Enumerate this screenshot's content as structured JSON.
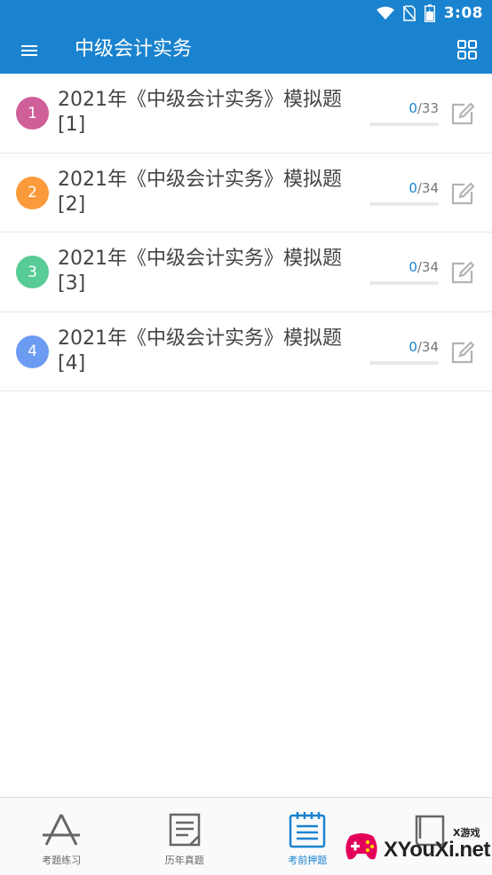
{
  "status_bar": {
    "time": "3:08"
  },
  "app_bar": {
    "title": "中级会计实务",
    "menu_icon": "hamburger-menu-icon",
    "grid_icon": "grid-view-icon"
  },
  "colors": {
    "primary": "#1a83cf"
  },
  "exams": [
    {
      "index": "1",
      "title": "2021年《中级会计实务》模拟题[1]",
      "done": "0",
      "total": "/33",
      "done_fraction": 0,
      "badge_color": "#cf5f99"
    },
    {
      "index": "2",
      "title": "2021年《中级会计实务》模拟题[2]",
      "done": "0",
      "total": "/34",
      "done_fraction": 0,
      "badge_color": "#fb9a3a"
    },
    {
      "index": "3",
      "title": "2021年《中级会计实务》模拟题[3]",
      "done": "0",
      "total": "/34",
      "done_fraction": 0,
      "badge_color": "#58cc97"
    },
    {
      "index": "4",
      "title": "2021年《中级会计实务》模拟题[4]",
      "done": "0",
      "total": "/34",
      "done_fraction": 0,
      "badge_color": "#6c9bf2"
    }
  ],
  "tabs": [
    {
      "label": "考题练习",
      "icon": "app-store-icon",
      "active": false
    },
    {
      "label": "历年真题",
      "icon": "document-icon",
      "active": false
    },
    {
      "label": "考前押题",
      "icon": "notepad-icon",
      "active": true
    },
    {
      "label": "",
      "icon": "book-icon",
      "active": false
    }
  ],
  "watermark": {
    "text": "XYouXi.net",
    "sub": "X游戏"
  }
}
